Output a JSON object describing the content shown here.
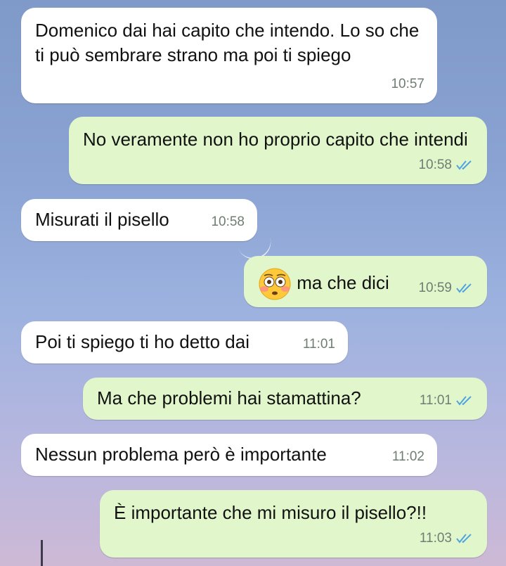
{
  "colors": {
    "incoming_bubble": "#ffffff",
    "outgoing_bubble": "#e1f7cb",
    "read_tick": "#4fa3e0"
  },
  "messages": [
    {
      "direction": "incoming",
      "text": "Domenico dai hai capito che intendo. Lo so che ti può sembrare strano ma poi ti spiego",
      "time": "10:57"
    },
    {
      "direction": "outgoing",
      "text": "No veramente non ho proprio capito che intendi",
      "time": "10:58",
      "status": "read-double-check-icon"
    },
    {
      "direction": "incoming",
      "text": "Misurati il pisello",
      "time": "10:58"
    },
    {
      "direction": "outgoing",
      "emoji": "flushed-face-emoji",
      "text": "ma che dici",
      "time": "10:59",
      "status": "read-double-check-icon"
    },
    {
      "direction": "incoming",
      "text": "Poi ti spiego ti ho detto dai",
      "time": "11:01"
    },
    {
      "direction": "outgoing",
      "text": "Ma che problemi hai stamattina?",
      "time": "11:01",
      "status": "read-double-check-icon"
    },
    {
      "direction": "incoming",
      "text": "Nessun problema però è importante",
      "time": "11:02"
    },
    {
      "direction": "outgoing",
      "text": "È importante che mi misuro il pisello?!!",
      "time": "11:03",
      "status": "read-double-check-icon"
    }
  ]
}
